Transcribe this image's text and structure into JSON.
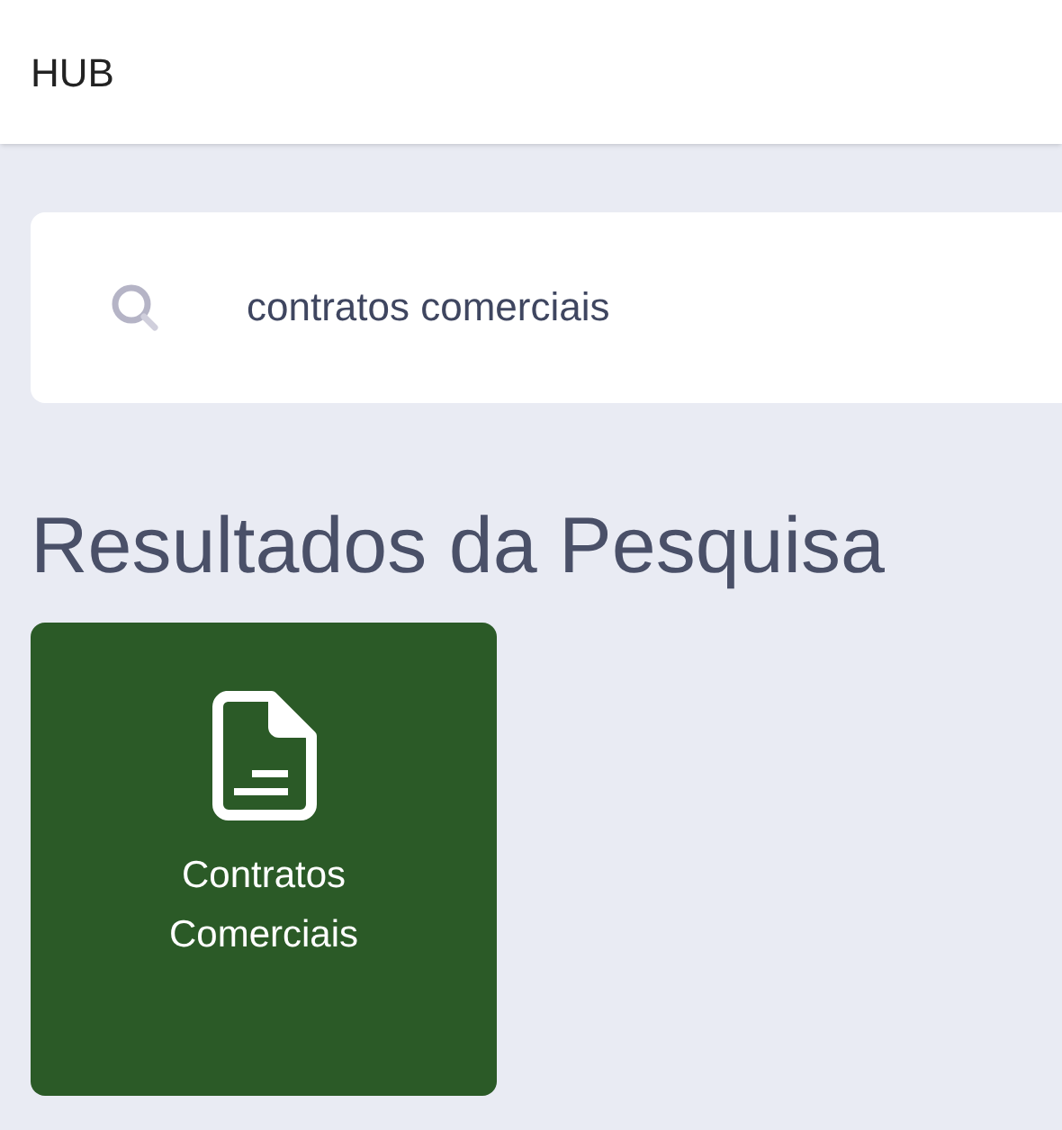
{
  "header": {
    "title": "HUB"
  },
  "search": {
    "value": "contratos comerciais"
  },
  "results": {
    "title": "Resultados da Pesquisa",
    "items": [
      {
        "label": "Contratos Comerciais",
        "kind": "document"
      }
    ]
  }
}
